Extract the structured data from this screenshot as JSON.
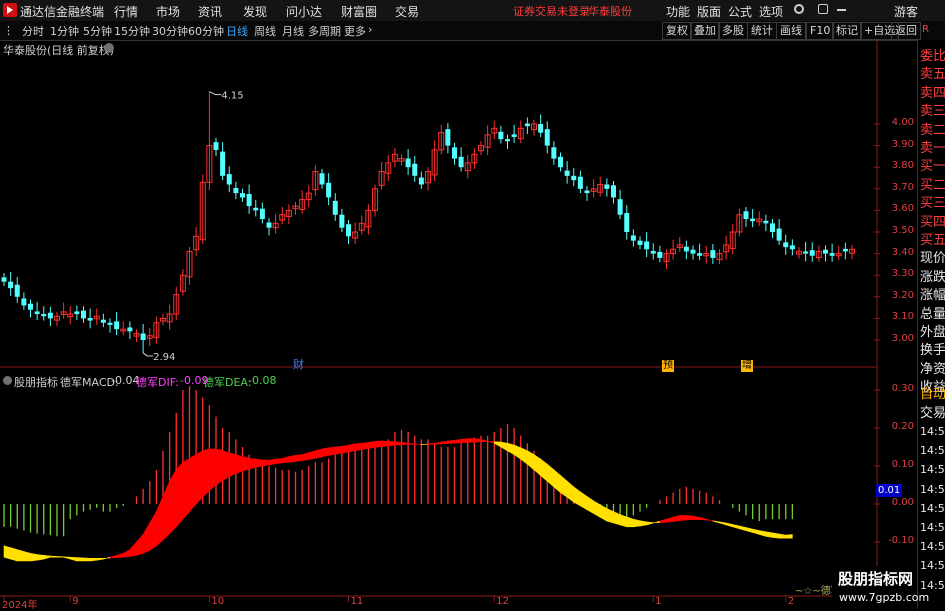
{
  "titlebar": {
    "app_title": "通达信金融终端",
    "menu": [
      "行情",
      "市场",
      "资讯",
      "发现",
      "问小达",
      "财富圈",
      "交易"
    ],
    "alert": "证券交易未登录",
    "stock_name": "华泰股份",
    "right_menu": [
      "功能",
      "版面",
      "公式",
      "选项"
    ],
    "user": "游客"
  },
  "periodbar": {
    "periods": [
      "分时",
      "1分钟",
      "5分钟",
      "15分钟",
      "30分钟",
      "60分钟",
      "日线",
      "周线",
      "月线",
      "多周期",
      "更多"
    ],
    "active": "日线",
    "more_arrow": "›",
    "tools": [
      "复权",
      "叠加",
      "多股",
      "统计",
      "画线",
      "F10",
      "标记",
      "+自选",
      "返回"
    ]
  },
  "main_chart": {
    "title": "华泰股份(日线 前复权)",
    "high_label": "4.15",
    "low_label": "2.94",
    "markers": [
      "财",
      "预",
      "增"
    ]
  },
  "indicator": {
    "name": "股朋指标",
    "macd_label": "德军MACD:",
    "macd_value": "-0.04",
    "dif_label": "德军DIF:",
    "dif_value": "-0.09",
    "dea_label": "德军DEA:",
    "dea_value": "-0.08",
    "current_value": "0.01",
    "bottom_tag": "~☆~德军"
  },
  "sidepanel": {
    "items": [
      "委比",
      "卖五",
      "卖四",
      "卖三",
      "卖二",
      "卖一",
      "买一",
      "买二",
      "买三",
      "买四",
      "买五",
      "现价",
      "涨跌",
      "涨幅",
      "总量",
      "外盘",
      "换手",
      "净资",
      "收益"
    ],
    "lower_items": [
      "自动",
      "交易"
    ],
    "times": [
      "14:55",
      "14:55",
      "14:55",
      "14:56",
      "14:56",
      "14:56",
      "14:56",
      "14:56",
      "14:56"
    ]
  },
  "watermark": {
    "line1": "股朋指标网",
    "line2": "www.7gpzb.com"
  },
  "colors": {
    "up": "#ff3030",
    "down": "#54ffff",
    "dif_fill_up": "#ff0000",
    "dif_fill_down": "#ffe000",
    "macd_up": "#ff3030",
    "macd_down": "#74d030",
    "axis": "#8b1a1a"
  },
  "chart_data": [
    {
      "type": "candlestick",
      "title": "华泰股份(日线 前复权)",
      "ylim": [
        2.9,
        4.18
      ],
      "yticks": [
        3.0,
        3.1,
        3.2,
        3.3,
        3.4,
        3.5,
        3.6,
        3.7,
        3.8,
        3.9,
        4.0
      ],
      "x_ticks": [
        "2024年",
        "9",
        "10",
        "11",
        "12",
        "1",
        "2"
      ],
      "x_tick_index": [
        0,
        10,
        31,
        52,
        74,
        98,
        118
      ],
      "annotations": [
        {
          "text": "4.15",
          "index": 31,
          "value": 4.15
        },
        {
          "text": "2.94",
          "index": 21,
          "value": 2.94
        }
      ],
      "closes": [
        3.27,
        3.24,
        3.2,
        3.16,
        3.14,
        3.12,
        3.11,
        3.1,
        3.11,
        3.13,
        3.12,
        3.12,
        3.1,
        3.09,
        3.11,
        3.08,
        3.07,
        3.05,
        3.05,
        3.04,
        3.03,
        3.0,
        3.02,
        3.08,
        3.1,
        3.12,
        3.21,
        3.3,
        3.41,
        3.48,
        3.73,
        3.9,
        3.88,
        3.76,
        3.72,
        3.68,
        3.66,
        3.62,
        3.6,
        3.56,
        3.52,
        3.54,
        3.58,
        3.6,
        3.62,
        3.65,
        3.68,
        3.78,
        3.72,
        3.66,
        3.58,
        3.52,
        3.48,
        3.5,
        3.54,
        3.6,
        3.7,
        3.78,
        3.82,
        3.86,
        3.84,
        3.8,
        3.76,
        3.72,
        3.78,
        3.88,
        3.96,
        3.9,
        3.84,
        3.8,
        3.82,
        3.86,
        3.9,
        3.95,
        3.98,
        3.93,
        3.92,
        3.94,
        3.98,
        3.99,
        4.0,
        3.96,
        3.9,
        3.84,
        3.8,
        3.76,
        3.74,
        3.7,
        3.68,
        3.7,
        3.72,
        3.7,
        3.66,
        3.58,
        3.5,
        3.46,
        3.44,
        3.42,
        3.4,
        3.38,
        3.4,
        3.42,
        3.44,
        3.41,
        3.4,
        3.39,
        3.4,
        3.38,
        3.4,
        3.44,
        3.5,
        3.58,
        3.56,
        3.55,
        3.56,
        3.54,
        3.5,
        3.46,
        3.43,
        3.42,
        3.41,
        3.4,
        3.39,
        3.41,
        3.4,
        3.39,
        3.4,
        3.41,
        3.42
      ]
    },
    {
      "type": "macd",
      "ylim": [
        -0.16,
        0.35
      ],
      "yticks": [
        0.3,
        0.2,
        0.1,
        0.0,
        -0.1
      ],
      "series": [
        {
          "name": "德军MACD",
          "values": [
            -0.06,
            -0.06,
            -0.065,
            -0.07,
            -0.075,
            -0.078,
            -0.08,
            -0.082,
            -0.085,
            -0.085,
            -0.04,
            -0.03,
            -0.02,
            -0.015,
            -0.01,
            -0.02,
            -0.02,
            -0.01,
            -0.005,
            0.0,
            0.02,
            0.04,
            0.06,
            0.09,
            0.14,
            0.19,
            0.24,
            0.3,
            0.31,
            0.3,
            0.28,
            0.26,
            0.23,
            0.2,
            0.19,
            0.17,
            0.15,
            0.13,
            0.12,
            0.11,
            0.1,
            0.095,
            0.09,
            0.09,
            0.085,
            0.09,
            0.1,
            0.11,
            0.11,
            0.12,
            0.13,
            0.14,
            0.145,
            0.15,
            0.15,
            0.15,
            0.155,
            0.16,
            0.17,
            0.19,
            0.195,
            0.19,
            0.18,
            0.17,
            0.17,
            0.16,
            0.15,
            0.15,
            0.15,
            0.16,
            0.17,
            0.175,
            0.18,
            0.18,
            0.19,
            0.2,
            0.21,
            0.2,
            0.18,
            0.16,
            0.14,
            0.12,
            0.1,
            0.08,
            0.06,
            0.04,
            0.02,
            0.01,
            0.0,
            -0.01,
            -0.02,
            -0.03,
            -0.035,
            -0.04,
            -0.04,
            -0.03,
            -0.02,
            -0.01,
            0.0,
            0.01,
            0.02,
            0.03,
            0.04,
            0.045,
            0.04,
            0.035,
            0.03,
            0.02,
            0.01,
            0.0,
            -0.01,
            -0.02,
            -0.03,
            -0.04,
            -0.045,
            -0.04,
            -0.04,
            -0.04,
            -0.04,
            -0.04
          ]
        },
        {
          "name": "德军DIF",
          "values": [
            -0.14,
            -0.145,
            -0.15,
            -0.15,
            -0.15,
            -0.148,
            -0.145,
            -0.14,
            -0.14,
            -0.14,
            -0.145,
            -0.15,
            -0.15,
            -0.15,
            -0.148,
            -0.145,
            -0.14,
            -0.135,
            -0.13,
            -0.12,
            -0.1,
            -0.08,
            -0.05,
            -0.02,
            0.02,
            0.06,
            0.09,
            0.11,
            0.12,
            0.13,
            0.14,
            0.145,
            0.145,
            0.14,
            0.135,
            0.13,
            0.125,
            0.12,
            0.118,
            0.116,
            0.115,
            0.118,
            0.12,
            0.125,
            0.128,
            0.13,
            0.135,
            0.14,
            0.145,
            0.148,
            0.15,
            0.152,
            0.155,
            0.158,
            0.16,
            0.162,
            0.165,
            0.166,
            0.165,
            0.164,
            0.162,
            0.16,
            0.158,
            0.156,
            0.158,
            0.16,
            0.163,
            0.166,
            0.168,
            0.17,
            0.172,
            0.172,
            0.17,
            0.165,
            0.16,
            0.15,
            0.14,
            0.13,
            0.118,
            0.105,
            0.09,
            0.075,
            0.06,
            0.045,
            0.03,
            0.018,
            0.005,
            -0.005,
            -0.015,
            -0.025,
            -0.035,
            -0.045,
            -0.05,
            -0.055,
            -0.06,
            -0.06,
            -0.058,
            -0.055,
            -0.05,
            -0.045,
            -0.04,
            -0.035,
            -0.03,
            -0.03,
            -0.032,
            -0.035,
            -0.04,
            -0.045,
            -0.05,
            -0.055,
            -0.06,
            -0.065,
            -0.07,
            -0.075,
            -0.08,
            -0.085,
            -0.088,
            -0.09,
            -0.09,
            -0.09
          ]
        },
        {
          "name": "德军DEA",
          "values": [
            -0.11,
            -0.115,
            -0.12,
            -0.125,
            -0.13,
            -0.133,
            -0.135,
            -0.137,
            -0.138,
            -0.139,
            -0.14,
            -0.141,
            -0.142,
            -0.143,
            -0.143,
            -0.143,
            -0.142,
            -0.141,
            -0.14,
            -0.138,
            -0.135,
            -0.13,
            -0.122,
            -0.11,
            -0.095,
            -0.078,
            -0.06,
            -0.04,
            -0.02,
            0.0,
            0.018,
            0.035,
            0.05,
            0.062,
            0.072,
            0.08,
            0.087,
            0.092,
            0.096,
            0.1,
            0.103,
            0.106,
            0.108,
            0.11,
            0.112,
            0.114,
            0.117,
            0.12,
            0.124,
            0.128,
            0.131,
            0.134,
            0.137,
            0.14,
            0.143,
            0.146,
            0.149,
            0.151,
            0.153,
            0.155,
            0.156,
            0.157,
            0.157,
            0.157,
            0.157,
            0.157,
            0.158,
            0.159,
            0.16,
            0.161,
            0.162,
            0.163,
            0.164,
            0.164,
            0.164,
            0.163,
            0.16,
            0.155,
            0.148,
            0.14,
            0.13,
            0.118,
            0.105,
            0.09,
            0.075,
            0.06,
            0.045,
            0.032,
            0.02,
            0.008,
            -0.002,
            -0.012,
            -0.02,
            -0.028,
            -0.034,
            -0.04,
            -0.044,
            -0.047,
            -0.049,
            -0.049,
            -0.048,
            -0.046,
            -0.044,
            -0.042,
            -0.041,
            -0.041,
            -0.042,
            -0.044,
            -0.047,
            -0.05,
            -0.054,
            -0.058,
            -0.062,
            -0.066,
            -0.07,
            -0.073,
            -0.076,
            -0.079,
            -0.082,
            -0.08
          ]
        }
      ]
    }
  ]
}
